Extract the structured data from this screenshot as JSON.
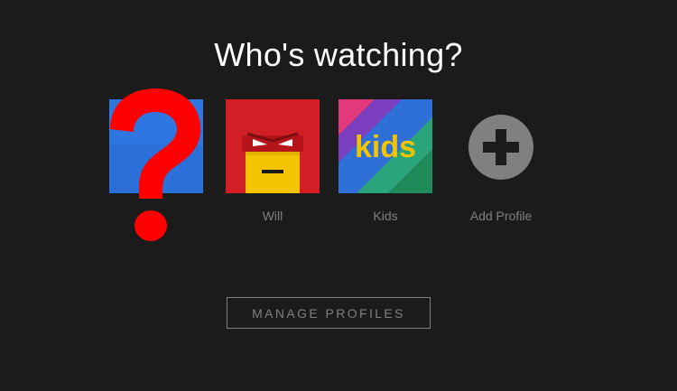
{
  "title": "Who's watching?",
  "profiles": [
    {
      "label": "",
      "avatar": "blue-default-avatar",
      "color": "#2b6fd8"
    },
    {
      "label": "Will",
      "avatar": "red-superhero-avatar",
      "color": "#d21f26"
    },
    {
      "label": "Kids",
      "avatar": "kids-avatar",
      "color": "#5b2fa0"
    },
    {
      "label": "Add Profile",
      "avatar": "plus-icon",
      "color": "#808080"
    }
  ],
  "manage_button": "MANAGE PROFILES",
  "overlay": {
    "icon": "question-mark-icon",
    "color": "#ff0000"
  },
  "colors": {
    "background": "#1b1b1b",
    "muted": "#808080",
    "text": "#ffffff"
  }
}
